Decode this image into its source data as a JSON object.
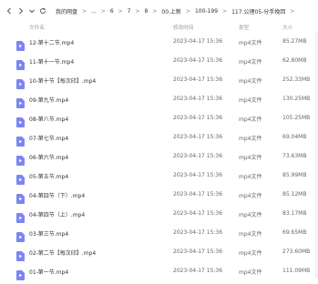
{
  "breadcrumb": {
    "items": [
      "我的网盘",
      "...",
      "6",
      "7",
      "8",
      "00.上新",
      "100-199",
      "117.公理05-分手挽回"
    ]
  },
  "columns": {
    "name": "文件名",
    "time": "修改时间",
    "type": "类型",
    "size": "大小"
  },
  "files": [
    {
      "name": "12-第十二节.mp4",
      "time": "2023-04-17 15:36",
      "type": "mp4文件",
      "size": "85.27MB"
    },
    {
      "name": "11-第十一节.mp4",
      "time": "2023-04-17 15:36",
      "type": "mp4文件",
      "size": "62.80MB"
    },
    {
      "name": "10-第十节【每次印】.mp4",
      "time": "2023-04-17 15:36",
      "type": "mp4文件",
      "size": "252.33MB"
    },
    {
      "name": "09-第九节.mp4",
      "time": "2023-04-17 15:36",
      "type": "mp4文件",
      "size": "130.25MB"
    },
    {
      "name": "08-第八节.mp4",
      "time": "2023-04-17 15:36",
      "type": "mp4文件",
      "size": "105.25MB"
    },
    {
      "name": "07-第七节.mp4",
      "time": "2023-04-17 15:36",
      "type": "mp4文件",
      "size": "69.04MB"
    },
    {
      "name": "06-第六节.mp4",
      "time": "2023-04-17 15:36",
      "type": "mp4文件",
      "size": "73.63MB"
    },
    {
      "name": "05-第五节.mp4",
      "time": "2023-04-17 15:36",
      "type": "mp4文件",
      "size": "85.99MB"
    },
    {
      "name": "04-第四节（下）.mp4",
      "time": "2023-04-17 15:36",
      "type": "mp4文件",
      "size": "85.12MB"
    },
    {
      "name": "04-第四节（上）.mp4",
      "time": "2023-04-17 15:36",
      "type": "mp4文件",
      "size": "83.17MB"
    },
    {
      "name": "03-第三节.mp4",
      "time": "2023-04-17 15:36",
      "type": "mp4文件",
      "size": "69.65MB"
    },
    {
      "name": "02-第二节【每次印】.mp4",
      "time": "2023-04-17 15:36",
      "type": "mp4文件",
      "size": "273.60MB"
    },
    {
      "name": "01-第一节.mp4",
      "time": "2023-04-17 15:36",
      "type": "mp4文件",
      "size": "111.09MB"
    }
  ],
  "icons": {
    "back": "chevron-left-icon",
    "forward": "chevron-right-icon",
    "dropdown": "chevron-down-icon",
    "refresh": "refresh-icon",
    "file": "video-file-icon"
  },
  "colors": {
    "file_icon": "#7b86f0",
    "header_text": "#999999"
  }
}
